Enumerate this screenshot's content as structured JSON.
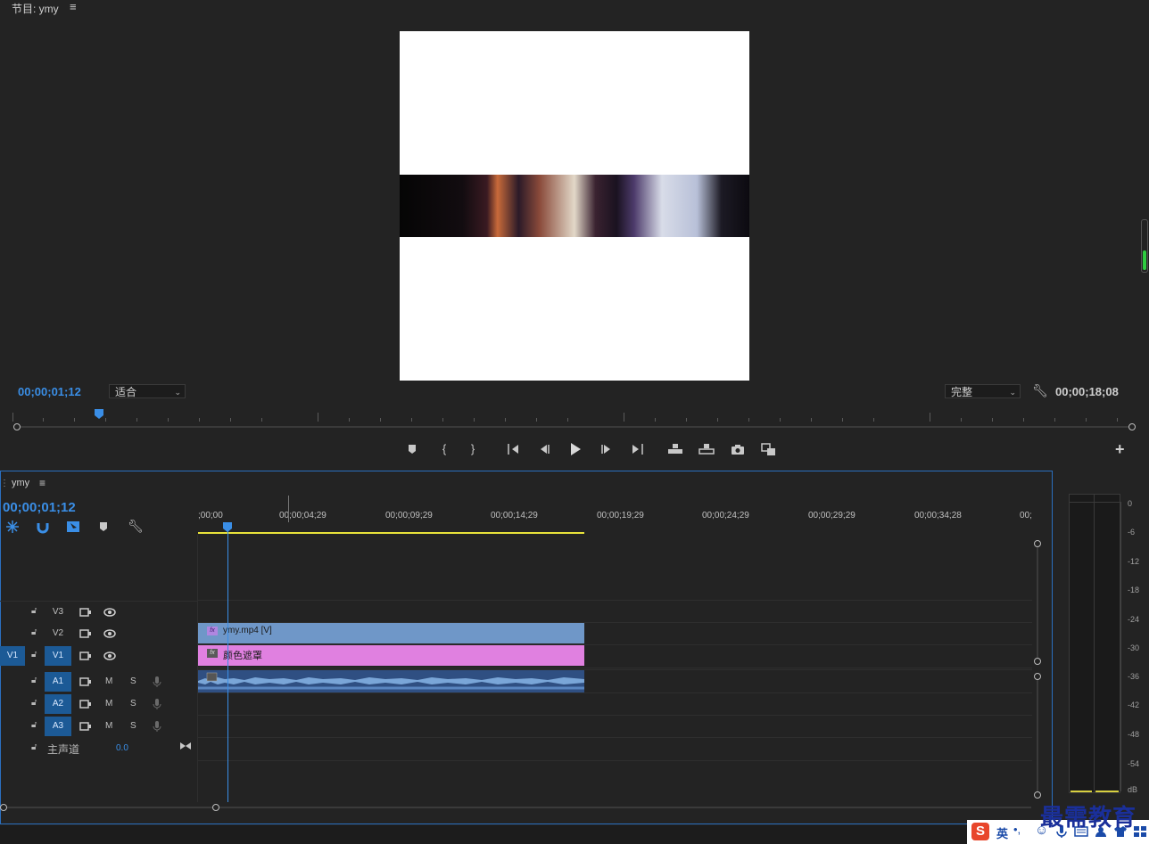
{
  "program": {
    "title": "节目: ymy",
    "menu_glyph": "≡",
    "current_time": "00;00;01;12",
    "fit": "适合",
    "quality": "完整",
    "duration": "00;00;18;08"
  },
  "transport": {
    "marker": "marker-icon",
    "mark_in": "{",
    "mark_out": "}",
    "go_in": "go-to-in-icon",
    "step_back": "step-back-icon",
    "play": "play-icon",
    "step_forward": "step-forward-icon",
    "go_out": "go-to-out-icon",
    "lift": "lift-icon",
    "extract": "extract-icon",
    "export_frame": "camera-icon",
    "compare": "compare-icon",
    "add": "+"
  },
  "timeline": {
    "sequence_name": "ymy",
    "menu_glyph": "≡",
    "current_time": "00;00;01;12",
    "ruler": [
      ";00;00",
      "00;00;04;29",
      "00;00;09;29",
      "00;00;14;29",
      "00;00;19;29",
      "00;00;24;29",
      "00;00;29;29",
      "00;00;34;28",
      "00;"
    ],
    "tracks": {
      "v3": "V3",
      "v2": "V2",
      "v1": "V1",
      "v1_src": "V1",
      "a1": "A1",
      "a2": "A2",
      "a3": "A3",
      "m": "M",
      "s": "S",
      "master_label": "主声道",
      "master_value": "0.0"
    },
    "clips": {
      "v2_name": "ymy.mp4 [V]",
      "v1_name": "颜色遮罩",
      "fx": "fx"
    }
  },
  "meter": {
    "scale": [
      "0",
      "-6",
      "-12",
      "-18",
      "-24",
      "-30",
      "-36",
      "-42",
      "-48",
      "-54",
      "dB"
    ]
  },
  "overlay": {
    "ime_label": "英",
    "brand": "最需教育"
  }
}
